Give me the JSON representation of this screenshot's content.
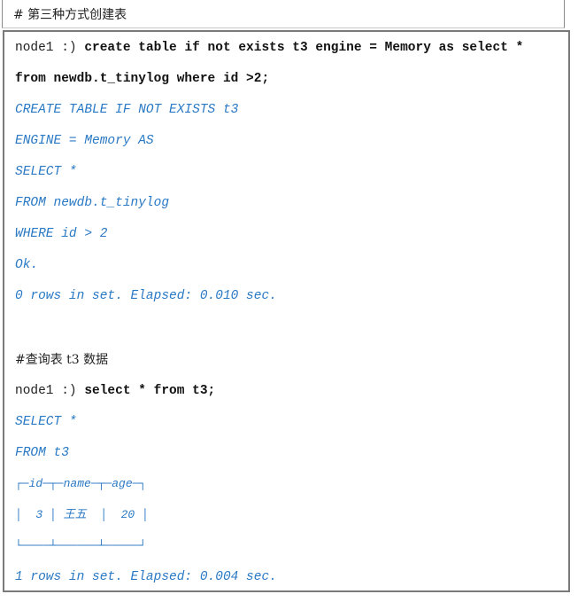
{
  "heading": "# 第三种方式创建表",
  "block1": {
    "prompt": "node1 :) ",
    "command_line1": "create table if not exists t3 engine = Memory as select *",
    "command_line2": "from newdb.t_tinylog where id >2;",
    "output": [
      "CREATE TABLE IF NOT EXISTS t3",
      "ENGINE = Memory AS",
      "SELECT *",
      "FROM newdb.t_tinylog",
      "WHERE id > 2",
      "Ok.",
      "0 rows in set. Elapsed: 0.010 sec."
    ]
  },
  "comment2": "#查询表 t3 数据",
  "block2": {
    "prompt": "node1 :) ",
    "command": "select * from t3;",
    "output": [
      "SELECT *",
      "FROM t3"
    ],
    "table": {
      "header_line": "┌─id─┬─name─┬─age─┐",
      "row_line": "│  3 │ 王五  │  20 │",
      "footer_line": "└────┴──────┴─────┘",
      "columns": [
        "id",
        "name",
        "age"
      ],
      "rows": [
        [
          "3",
          "王五",
          "20"
        ]
      ]
    },
    "summary": "1 rows in set. Elapsed: 0.004 sec."
  }
}
